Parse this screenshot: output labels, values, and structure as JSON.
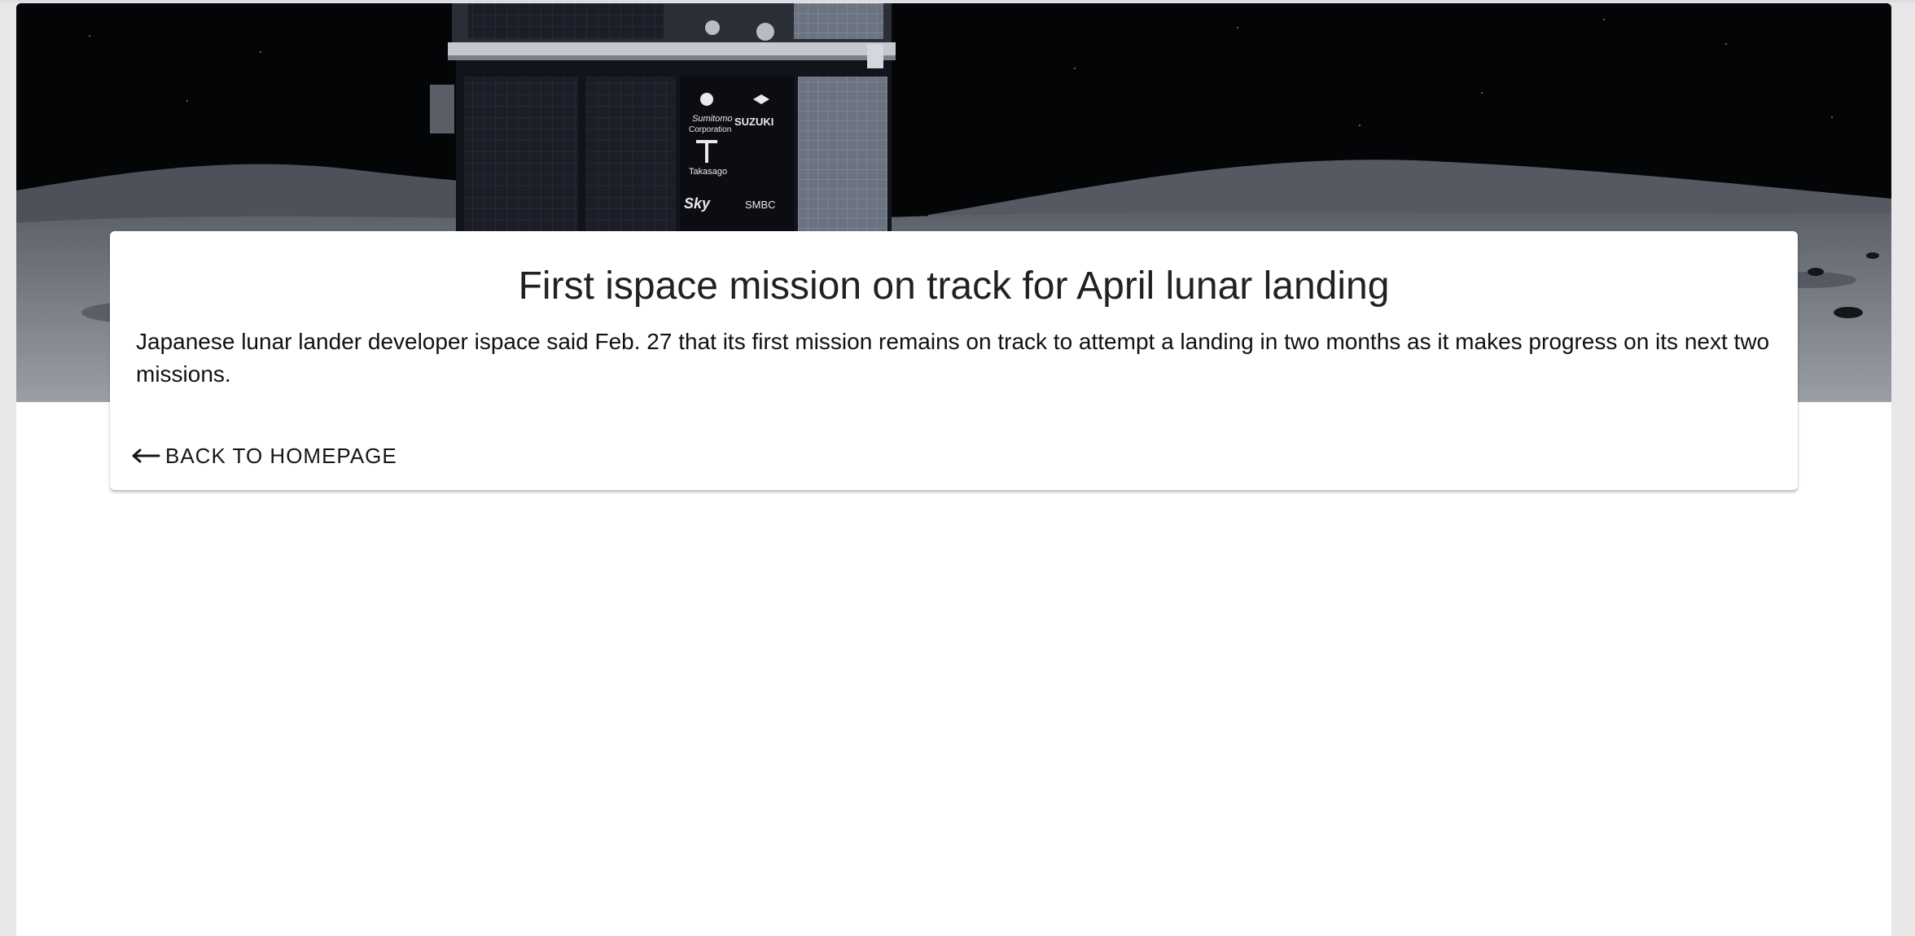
{
  "hero": {
    "image_alt": "Lunar lander on the Moon surface",
    "lander_logos": [
      "Sumitomo Corporation",
      "SUZUKI",
      "Takasago",
      "Sky",
      "SMBC"
    ]
  },
  "article": {
    "title": "First ispace mission on track for April lunar landing",
    "summary": "Japanese lunar lander developer ispace said Feb. 27 that its first mission remains on track to attempt a landing in two months as it makes progress on its next two missions."
  },
  "navigation": {
    "back_label": "BACK TO HOMEPAGE",
    "back_icon": "arrow-left-icon"
  }
}
